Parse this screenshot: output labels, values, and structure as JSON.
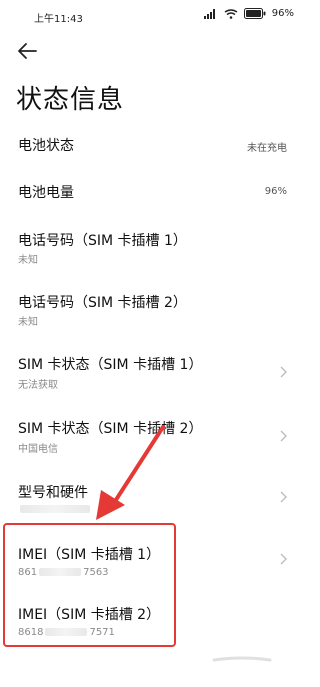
{
  "status": {
    "time": "上午11:43",
    "battery_pct": "96%"
  },
  "page": {
    "title": "状态信息"
  },
  "items": [
    {
      "label": "电池状态",
      "value": "未在充电"
    },
    {
      "label": "电池电量",
      "value": "96%"
    },
    {
      "label": "电话号码（SIM 卡插槽 1）",
      "sub": "未知"
    },
    {
      "label": "电话号码（SIM 卡插槽 2）",
      "sub": "未知"
    },
    {
      "label": "SIM 卡状态（SIM 卡插槽 1）",
      "sub": "无法获取"
    },
    {
      "label": "SIM 卡状态（SIM 卡插槽 2）",
      "sub": "中国电信"
    },
    {
      "label": "型号和硬件"
    },
    {
      "label": "IMEI（SIM 卡插槽 1）",
      "sub_start": "861",
      "sub_end": "7563"
    },
    {
      "label": "IMEI（SIM 卡插槽 2）",
      "sub_start": "8618",
      "sub_end": "7571"
    }
  ],
  "colors": {
    "annotation": "#e53935"
  },
  "icons": [
    "back-arrow-icon",
    "chevron-right-icon",
    "wifi-icon",
    "battery-icon",
    "signal-icon"
  ]
}
